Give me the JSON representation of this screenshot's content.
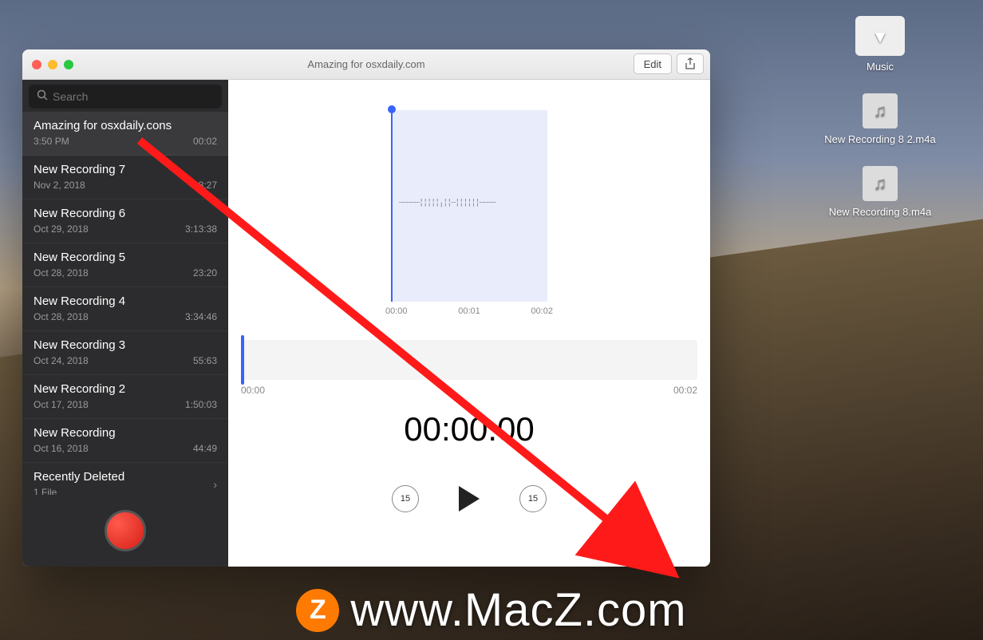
{
  "window": {
    "title": "Amazing for osxdaily.com",
    "edit_label": "Edit"
  },
  "search": {
    "placeholder": "Search"
  },
  "recordings": [
    {
      "title": "Amazing for osxdaily.con​s",
      "date": "3:50 PM",
      "duration": "00:02",
      "selected": true
    },
    {
      "title": "New Recording 7",
      "date": "Nov 2, 2018",
      "duration": "08:27"
    },
    {
      "title": "New Recording 6",
      "date": "Oct 29, 2018",
      "duration": "3:13:38"
    },
    {
      "title": "New Recording 5",
      "date": "Oct 28, 2018",
      "duration": "23:20"
    },
    {
      "title": "New Recording 4",
      "date": "Oct 28, 2018",
      "duration": "3:34:46"
    },
    {
      "title": "New Recording 3",
      "date": "Oct 24, 2018",
      "duration": "55:63"
    },
    {
      "title": "New Recording 2",
      "date": "Oct 17, 2018",
      "duration": "1:50:03"
    },
    {
      "title": "New Recording",
      "date": "Oct 16, 2018",
      "duration": "44:49"
    }
  ],
  "deleted": {
    "label": "Recently Deleted",
    "sub": "1 File"
  },
  "ticks_top": [
    "00:00",
    "00:01",
    "00:02"
  ],
  "scrub": {
    "start": "00:00",
    "end": "00:02"
  },
  "time_display": "00:00.00",
  "rewind_label": "15",
  "forward_label": "15",
  "desktop_icons": [
    {
      "type": "folder",
      "label": "Music",
      "glyph": "▾"
    },
    {
      "type": "audio",
      "label": "New Recording 8 2.m4a"
    },
    {
      "type": "audio",
      "label": "New Recording 8.m4a"
    }
  ],
  "watermark": {
    "badge": "Z",
    "text": "www.MacZ.com"
  }
}
